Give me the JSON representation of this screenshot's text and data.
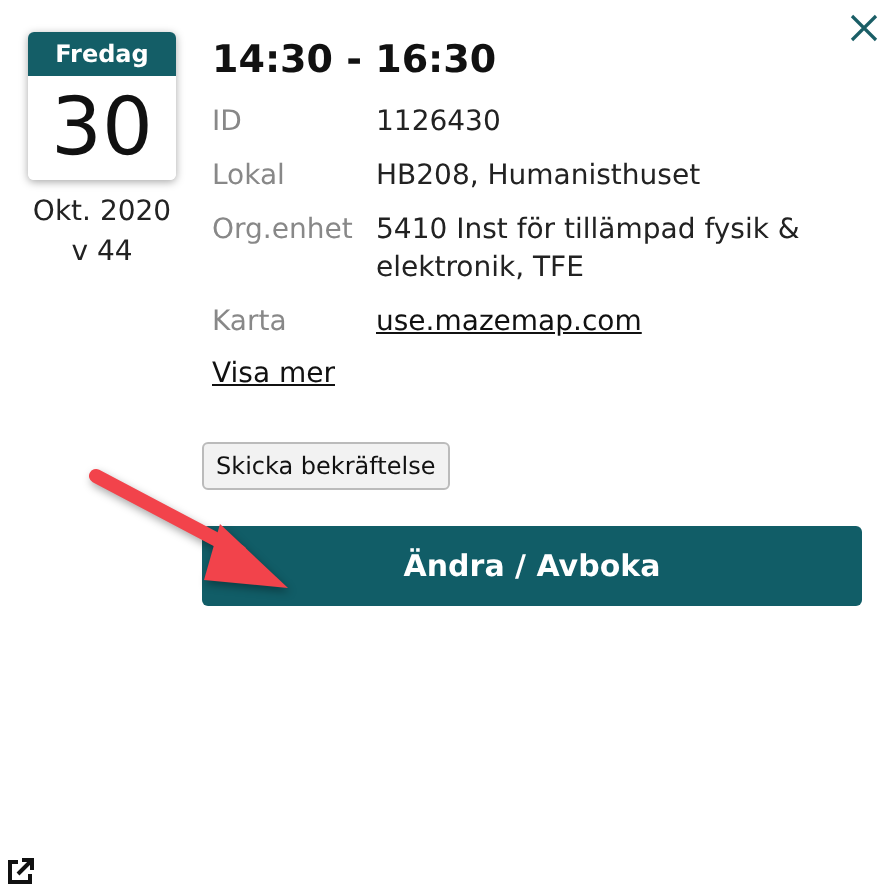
{
  "date_card": {
    "weekday": "Fredag",
    "day": "30",
    "month_year": "Okt. 2020",
    "week": "v 44"
  },
  "title": "14:30 - 16:30",
  "fields": [
    {
      "label": "ID",
      "value": "1126430",
      "kind": "text"
    },
    {
      "label": "Lokal",
      "value": "HB208, Humanisthuset",
      "kind": "text"
    },
    {
      "label": "Org.enhet",
      "value": "5410 Inst för tillämpad fysik & elektronik, TFE",
      "kind": "text"
    },
    {
      "label": "Karta",
      "value": "use.mazemap.com",
      "kind": "link"
    }
  ],
  "more_link": "Visa mer",
  "confirm_button": "Skicka bekräftelse",
  "primary_button": "Ändra / Avboka"
}
